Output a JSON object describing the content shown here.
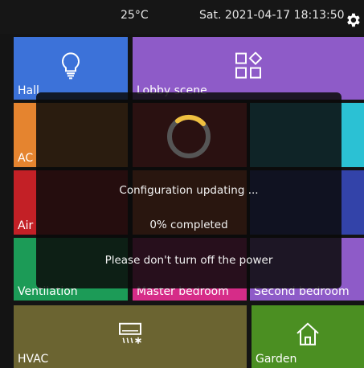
{
  "status_bar": {
    "temperature": "25°C",
    "datetime": "Sat. 2021-04-17 18:13:50",
    "settings_icon": "gear-icon"
  },
  "tiles": [
    {
      "label": "Hall",
      "icon": "lightbulb-icon",
      "color": "#3c72d9"
    },
    {
      "label": "Lobby scene",
      "icon": "scene-grid-icon",
      "color": "#8e5bc8"
    },
    {
      "label": "AC",
      "icon": "",
      "color": "#e5842f"
    },
    {
      "label": "",
      "icon": "",
      "color": "#e7383c"
    },
    {
      "label": "",
      "icon": "",
      "color": "#2bc1d4"
    },
    {
      "label": "Air",
      "icon": "",
      "color": "#c32026"
    },
    {
      "label": "",
      "icon": "",
      "color": "#e25c2b"
    },
    {
      "label": "",
      "icon": "",
      "color": "#3343a9"
    },
    {
      "label": "Ventilation",
      "icon": "fan-icon",
      "color": "#1c9b57"
    },
    {
      "label": "Master bedroom",
      "icon": "bed-icon",
      "color": "#d62c88"
    },
    {
      "label": "Second bedroom",
      "icon": "bed-icon",
      "color": "#8e5bc8"
    },
    {
      "label": "HVAC",
      "icon": "hvac-icon",
      "color": "#6b6431"
    },
    {
      "label": "Garden",
      "icon": "house-icon",
      "color": "#4b8f22"
    }
  ],
  "dialog": {
    "title": "Configuration updating ...",
    "progress": "0% completed",
    "progress_fraction": 0.0,
    "warning": "Please don't turn off the power",
    "spinner_color": "#f0c040"
  }
}
